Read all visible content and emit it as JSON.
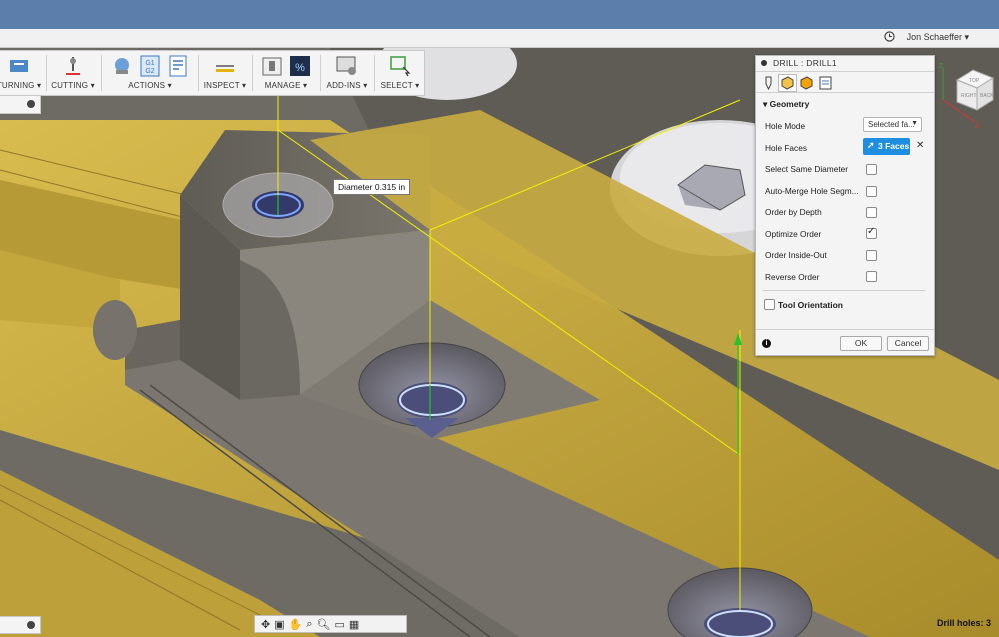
{
  "window": {
    "user_name": "Jon Schaeffer ▾"
  },
  "toolbar": {
    "groups": [
      {
        "label": "TURNING ▾"
      },
      {
        "label": "CUTTING ▾"
      },
      {
        "label": "ACTIONS ▾"
      },
      {
        "label": "INSPECT ▾"
      },
      {
        "label": "MANAGE ▾"
      },
      {
        "label": "ADD-INS ▾"
      },
      {
        "label": "SELECT ▾"
      }
    ],
    "gcode_icon_text": "G1\nG2"
  },
  "tooltip": {
    "text": "Diameter 0.315 in"
  },
  "dialog": {
    "title": "DRILL : DRILL1",
    "section_geometry": "Geometry",
    "hole_mode_label": "Hole Mode",
    "hole_mode_value": "Selected fa...",
    "hole_faces_label": "Hole Faces",
    "hole_faces_value": "3 Faces",
    "options": [
      {
        "label": "Select Same Diameter",
        "checked": false
      },
      {
        "label": "Auto-Merge Hole Segm...",
        "checked": false
      },
      {
        "label": "Order by Depth",
        "checked": false
      },
      {
        "label": "Optimize Order",
        "checked": true
      },
      {
        "label": "Order Inside-Out",
        "checked": false
      },
      {
        "label": "Reverse Order",
        "checked": false
      }
    ],
    "section_tool_orientation": "Tool Orientation",
    "ok_label": "OK",
    "cancel_label": "Cancel",
    "info_icon_text": "i"
  },
  "viewcube": {
    "labels": [
      "TOP",
      "RIGHT",
      "BACK"
    ]
  },
  "status": {
    "text": "Drill holes: 3"
  },
  "colors": {
    "accent": "#1e8fe0",
    "titlebar": "#5b7eaa",
    "part_gold": "#c6a73b",
    "part_grey": "#6d6a63"
  }
}
